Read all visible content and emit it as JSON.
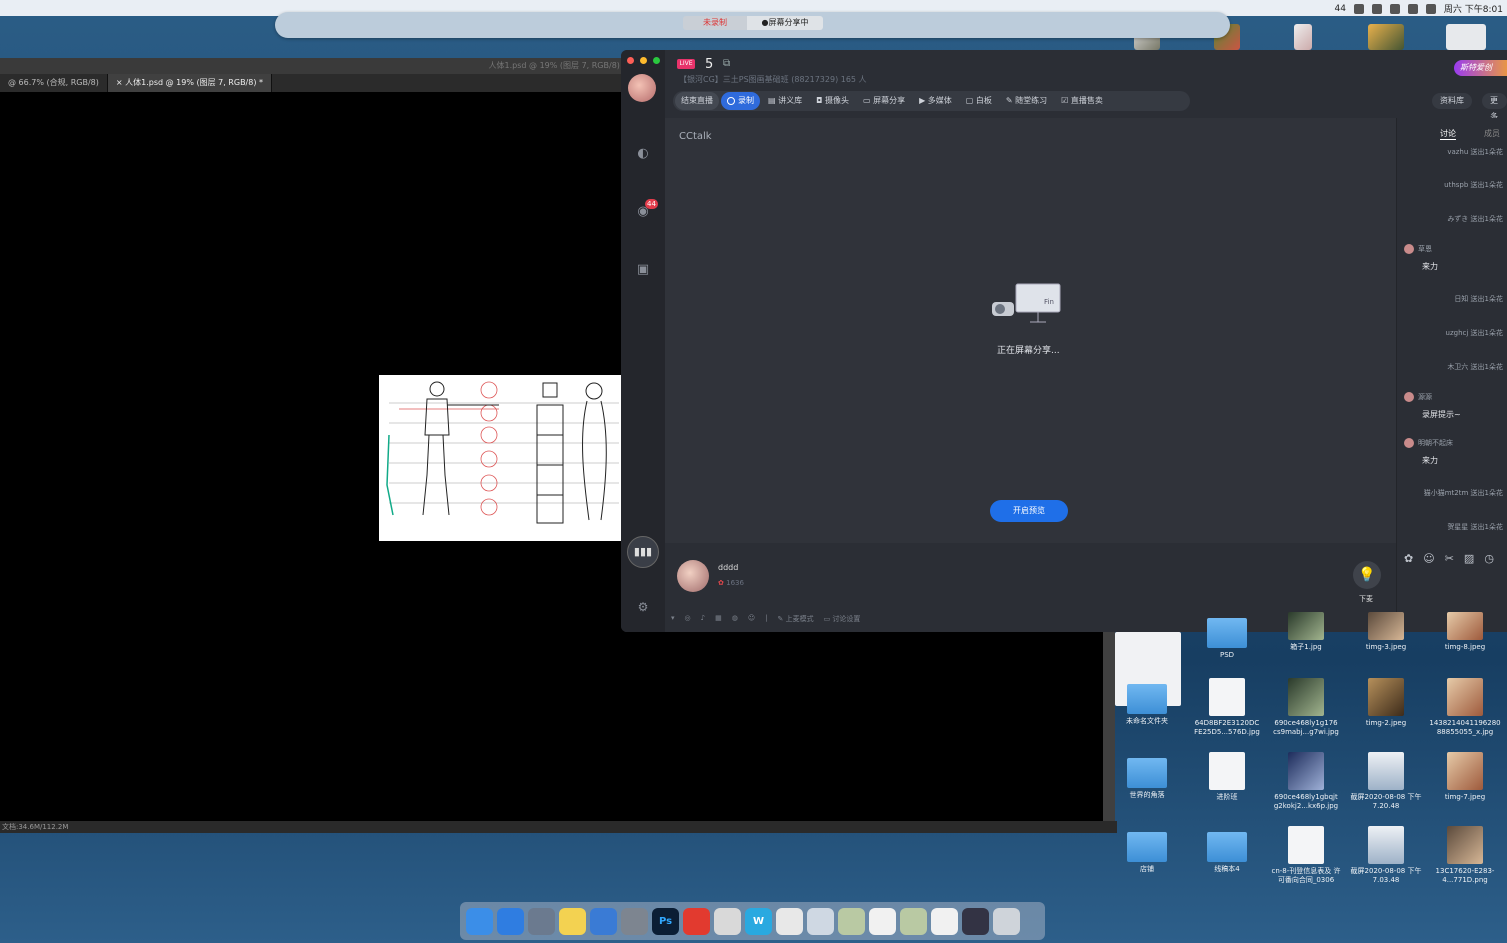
{
  "menubar": {
    "right_items": [
      "44",
      "周六 下午8:01"
    ]
  },
  "share_toolbar": {
    "record_label": "未录制",
    "sharing_label": "●屏幕分享中"
  },
  "photoshop": {
    "title": "人体1.psd @ 19% (图层 7, RGB/8) *",
    "tabs": [
      {
        "label": "@ 66.7% (合规, RGB/8)"
      },
      {
        "label": "× 人体1.psd @ 19% (图层 7, RGB/8) *"
      }
    ],
    "status": "文档:34.6M/112.2M"
  },
  "cctalk": {
    "live_tag": "LIVE",
    "room_number": "5",
    "room_info": "【银河CG】三土PS图画基础班 (88217329)   165 人",
    "brand": "斯特爱创",
    "toolbar": {
      "end_label": "结束直播",
      "record_label": "录制",
      "items": [
        "讲义库",
        "摄像头",
        "屏幕分享",
        "多媒体",
        "白板",
        "随堂练习",
        "直播售卖"
      ]
    },
    "right_buttons": [
      "资料库",
      "更多"
    ],
    "stage_label": "CCtalk",
    "sharing_text": "正在屏幕分享...",
    "projector_text": "Fin",
    "preview_button": "开启预览",
    "host": {
      "name": "dddd",
      "score": "1636"
    },
    "bulb_label": "下麦",
    "bottom_tools": [
      "上麦模式",
      "讨论设置"
    ],
    "badge_count": "44",
    "chat": {
      "tabs": [
        "讨论",
        "成员"
      ],
      "messages": [
        {
          "text": "vazhu 送出1朵花"
        },
        {
          "text": "uthspb 送出1朵花"
        },
        {
          "text": "みずき 送出1朵花"
        },
        {
          "user": "草恩",
          "text": "来力"
        },
        {
          "text": "日知 送出1朵花"
        },
        {
          "text": "uzghcj 送出1朵花"
        },
        {
          "text": "木卫六 送出1朵花"
        },
        {
          "user": "源源",
          "text": "录屏提示~"
        },
        {
          "user": "明朝不起床",
          "text": "来力"
        },
        {
          "text": "猫小猫mt2tm 送出1朵花"
        },
        {
          "text": "贺星星 送出1朵花"
        }
      ]
    }
  },
  "desktop_icons": [
    {
      "label": "PSD",
      "kind": "folder"
    },
    {
      "label": "箱子1.jpg",
      "kind": "photo2"
    },
    {
      "label": "timg-3.jpeg",
      "kind": "photo1"
    },
    {
      "label": "timg-8.jpeg",
      "kind": "photo4"
    },
    {
      "label": "未命名文件夹",
      "kind": "folder"
    },
    {
      "label": "64D8BF2E3120DC FE25D5...576D.jpg",
      "kind": "docicon"
    },
    {
      "label": "690ce468ly1g176 cs9mabj...g7wi.jpg",
      "kind": "photo2"
    },
    {
      "label": "timg-2.jpeg",
      "kind": "photo3"
    },
    {
      "label": "1438214041196280 88855055_x.jpg",
      "kind": "photo4"
    },
    {
      "label": "世界的角落",
      "kind": "folder"
    },
    {
      "label": "进阶班",
      "kind": "docicon"
    },
    {
      "label": "690ce468ly1gbqjt g2kokj2...kx6p.jpg",
      "kind": "photo5"
    },
    {
      "label": "截屏2020-08-08 下午7.20.48",
      "kind": "shot"
    },
    {
      "label": "timg-7.jpeg",
      "kind": "photo4"
    },
    {
      "label": "店铺",
      "kind": "folder"
    },
    {
      "label": "线稿本4",
      "kind": "folder"
    },
    {
      "label": "cn-8-刊登信息表及 许可番向合同_0306",
      "kind": "docicon"
    },
    {
      "label": "截屏2020-08-08 下午7.03.48",
      "kind": "shot"
    },
    {
      "label": "13C17620-E283-4...771D.png",
      "kind": "photo1"
    }
  ],
  "dock": [
    "finder",
    "safari",
    "launchpad",
    "notes",
    "keynote",
    "system-preferences",
    "Ps",
    "netease-music",
    "photos",
    "W",
    "chrome",
    "preview",
    "image",
    "doc",
    "image",
    "doc",
    "screenshot",
    "trash"
  ]
}
